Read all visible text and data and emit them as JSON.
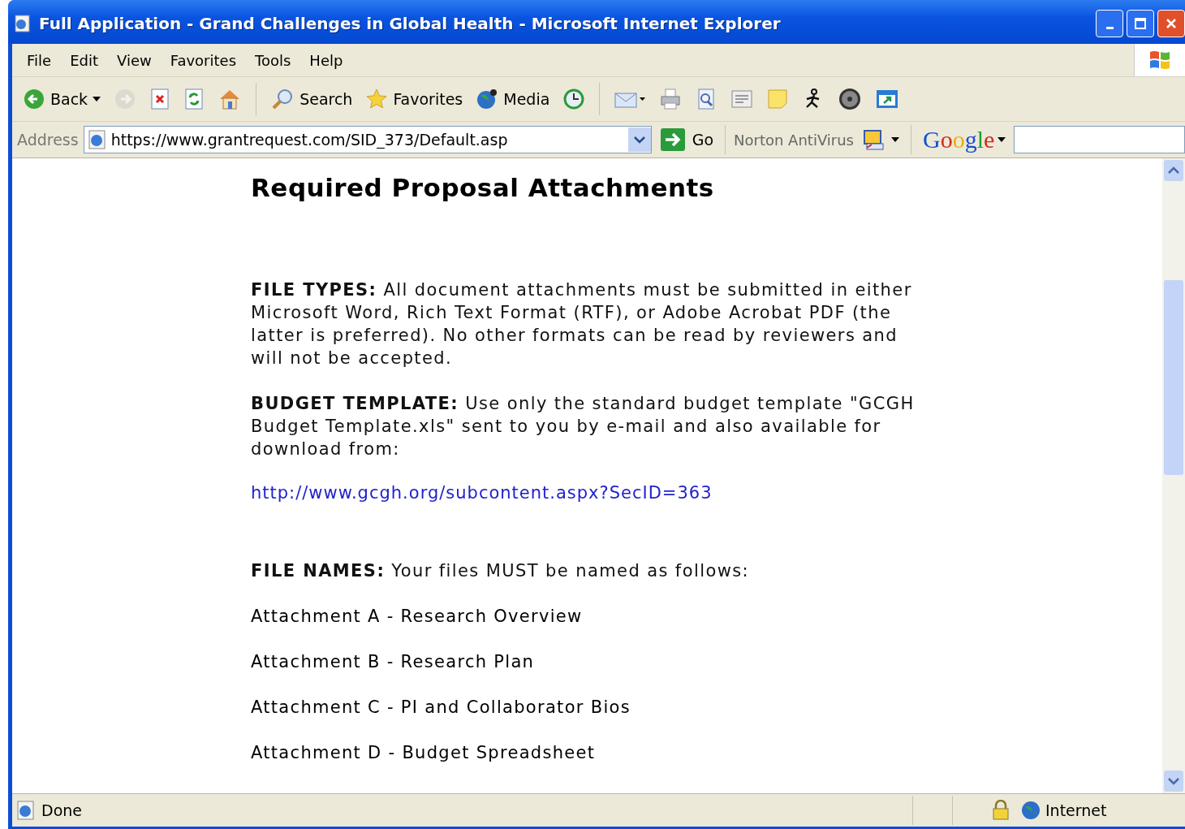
{
  "window": {
    "title": "Full Application - Grand Challenges in Global Health - Microsoft Internet Explorer"
  },
  "menu": [
    {
      "label": "File"
    },
    {
      "label": "Edit"
    },
    {
      "label": "View"
    },
    {
      "label": "Favorites"
    },
    {
      "label": "Tools"
    },
    {
      "label": "Help"
    }
  ],
  "toolbar": [
    {
      "kind": "back",
      "label": "Back",
      "disabled": false
    },
    {
      "kind": "forward",
      "disabled": true
    },
    {
      "kind": "stop",
      "disabled": false
    },
    {
      "kind": "refresh",
      "disabled": false
    },
    {
      "kind": "home",
      "disabled": false
    },
    {
      "kind": "separator",
      "disabled": false
    },
    {
      "kind": "search",
      "label": "Search",
      "disabled": false
    },
    {
      "kind": "favorites",
      "label": "Favorites",
      "disabled": false
    },
    {
      "kind": "media",
      "label": "Media",
      "disabled": false
    },
    {
      "kind": "history",
      "disabled": false
    },
    {
      "kind": "separator",
      "disabled": false
    },
    {
      "kind": "mail",
      "disabled": false
    },
    {
      "kind": "print",
      "disabled": false
    },
    {
      "kind": "preview",
      "disabled": false
    },
    {
      "kind": "edit",
      "disabled": false
    },
    {
      "kind": "note",
      "disabled": false
    },
    {
      "kind": "messenger",
      "disabled": false
    },
    {
      "kind": "disc",
      "disabled": false
    },
    {
      "kind": "window",
      "disabled": false
    }
  ],
  "address_bar": {
    "label": "Address",
    "value": "https://www.grantrequest.com/SID_373/Default.asp",
    "go": "Go",
    "norton": "Norton AntiVirus",
    "google": "Google"
  },
  "content": [
    {
      "kind": "heading",
      "text": "Required Proposal Attachments"
    },
    {
      "kind": "paragraph",
      "text": "**FILE TYPES:** All document attachments must be submitted in either Microsoft Word, Rich Text Format (RTF), or Adobe Acrobat PDF (the latter is preferred). No other formats can be read by reviewers and will not be accepted."
    },
    {
      "kind": "paragraph",
      "text": "**BUDGET TEMPLATE:** Use only the standard budget template \"GCGH Budget Template.xls\" sent to you by e-mail and also available for download from:"
    },
    {
      "kind": "link",
      "text": "http://www.gcgh.org/subcontent.aspx?SecID=363"
    },
    {
      "kind": "paragraph",
      "text": "**FILE NAMES:** Your files MUST be named as follows:"
    },
    {
      "kind": "item",
      "text": "Attachment A - Research Overview"
    },
    {
      "kind": "item",
      "text": "Attachment B - Research Plan"
    },
    {
      "kind": "item",
      "text": "Attachment C - PI and Collaborator Bios"
    },
    {
      "kind": "item",
      "text": "Attachment D - Budget Spreadsheet"
    }
  ],
  "status_bar": {
    "text": "Done",
    "zone": "Internet"
  }
}
